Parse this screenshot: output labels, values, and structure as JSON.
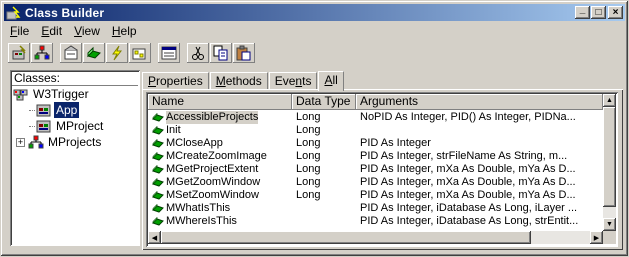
{
  "window": {
    "title": "Class Builder",
    "buttons": [
      "_",
      "□",
      "×"
    ]
  },
  "menu": [
    {
      "label": "File",
      "accel": "F",
      "rest": "ile"
    },
    {
      "label": "Edit",
      "accel": "E",
      "rest": "dit"
    },
    {
      "label": "View",
      "accel": "V",
      "rest": "iew"
    },
    {
      "label": "Help",
      "accel": "H",
      "rest": "elp"
    }
  ],
  "toolbar": {
    "icons": [
      "new-class-icon",
      "new-collection-icon",
      "new-property-icon",
      "new-method-icon",
      "new-event-icon",
      "new-enum-icon",
      "properties-icon",
      "cut-icon",
      "copy-icon",
      "paste-icon"
    ]
  },
  "tree": {
    "header": "Classes:",
    "items": [
      {
        "label": "W3Trigger",
        "level": 0,
        "icon": "project-icon",
        "expand": ""
      },
      {
        "label": "App",
        "level": 1,
        "icon": "class-module-icon",
        "selected": true
      },
      {
        "label": "MProject",
        "level": 1,
        "icon": "class-module-icon"
      },
      {
        "label": "MProjects",
        "level": 0,
        "icon": "collection-icon",
        "expand": "+"
      }
    ]
  },
  "tabs": [
    {
      "label": "Properties",
      "pre": "",
      "accel": "P",
      "post": "roperties"
    },
    {
      "label": "Methods",
      "pre": "",
      "accel": "M",
      "post": "ethods"
    },
    {
      "label": "Events",
      "pre": "Eve",
      "accel": "n",
      "post": "ts"
    },
    {
      "label": "All",
      "pre": "",
      "accel": "A",
      "post": "ll",
      "active": true
    }
  ],
  "table": {
    "columns": [
      "Name",
      "Data Type",
      "Arguments"
    ],
    "rows": [
      {
        "name": "AccessibleProjects",
        "type": "Long",
        "args": "NoPID As Integer, PID() As Integer, PIDNa...",
        "highlight": true
      },
      {
        "name": "Init",
        "type": "Long",
        "args": ""
      },
      {
        "name": "MCloseApp",
        "type": "Long",
        "args": "PID As Integer"
      },
      {
        "name": "MCreateZoomImage",
        "type": "Long",
        "args": "PID As Integer, strFileName As String, m..."
      },
      {
        "name": "MGetProjectExtent",
        "type": "Long",
        "args": "PID As Integer, mXa As Double, mYa As D..."
      },
      {
        "name": "MGetZoomWindow",
        "type": "Long",
        "args": "PID As Integer, mXa As Double, mYa As D..."
      },
      {
        "name": "MSetZoomWindow",
        "type": "Long",
        "args": "PID As Integer, mXa As Double, mYa As D..."
      },
      {
        "name": "MWhatIsThis",
        "type": "",
        "args": "PID As Integer, iDatabase As Long, iLayer ..."
      },
      {
        "name": "MWhereIsThis",
        "type": "",
        "args": "PID As Integer, iDatabase As Long, strEntit..."
      }
    ]
  },
  "colors": {
    "title_start": "#0a246a",
    "title_end": "#a6caf0",
    "face": "#d4d0c8",
    "selected": "#0a246a"
  }
}
